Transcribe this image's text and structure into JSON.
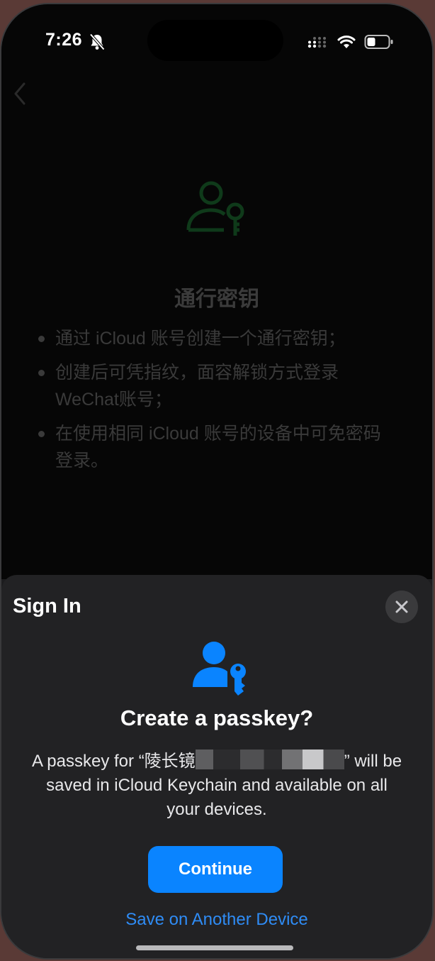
{
  "status_bar": {
    "time": "7:26",
    "icons": [
      "bell-slash-icon",
      "cellular-signal-icon",
      "wifi-icon",
      "battery-icon"
    ]
  },
  "background_page": {
    "back_icon": "chevron-left-icon",
    "icon": "person-key-icon",
    "title": "通行密钥",
    "bullets": [
      "通过 iCloud 账号创建一个通行密钥；",
      "创建后可凭指纹，面容解锁方式登录 WeChat账号；",
      "在使用相同 iCloud 账号的设备中可免密码登录。"
    ]
  },
  "sheet": {
    "title": "Sign In",
    "close_icon": "close-icon",
    "icon": "person-key-icon",
    "heading": "Create a passkey?",
    "desc_prefix": "A passkey for “陵长镜",
    "desc_suffix": "” will be saved in iCloud Keychain and available on all your devices.",
    "continue_label": "Continue",
    "save_other_label": "Save on Another Device"
  },
  "colors": {
    "accent": "#0a84ff",
    "link": "#2f8cf5",
    "background_icon_green": "#0f3a1a"
  }
}
